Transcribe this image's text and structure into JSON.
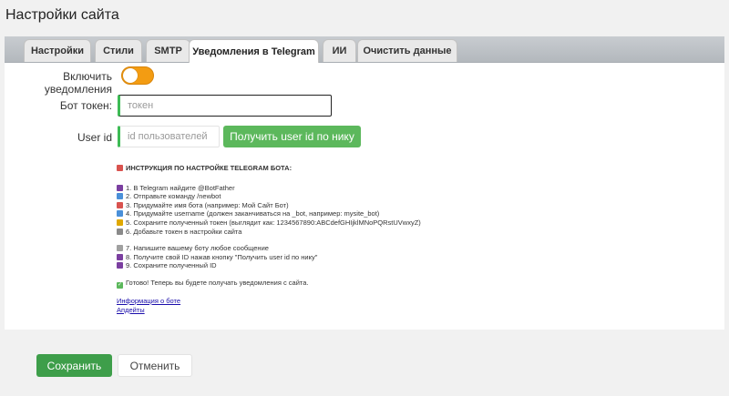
{
  "page": {
    "title": "Настройки сайта"
  },
  "tabs": [
    {
      "label": "Настройки"
    },
    {
      "label": "Стили"
    },
    {
      "label": "SMTP"
    },
    {
      "label": "Уведомления в Telegram",
      "active": true
    },
    {
      "label": "ИИ"
    },
    {
      "label": "Очистить данные"
    }
  ],
  "form": {
    "enable_label": "Включить уведомления",
    "enable_value": true,
    "token_label": "Бот токен:",
    "token_placeholder": "токен",
    "token_value": "",
    "userid_label": "User id",
    "userid_placeholder": "id пользователей",
    "userid_value": "",
    "get_userid_button": "Получить user id по нику"
  },
  "instructions": {
    "heading": "ИНСТРУКЦИЯ ПО НАСТРОЙКЕ TELEGRAM БОТА:",
    "steps_a": [
      {
        "text": "1. В Telegram найдите @BotFather",
        "icon": "phone-icon",
        "color": "#7b3fa0"
      },
      {
        "text": "2. Отправьте команду /newbot",
        "icon": "new-icon",
        "color": "#4a90d9"
      },
      {
        "text": "3. Придумайте имя бота (например: Мой Сайт Бот)",
        "icon": "name-badge-icon",
        "color": "#d9534f"
      },
      {
        "text": "4. Придумайте username (должен заканчиваться на _bot, например: mysite_bot)",
        "icon": "abc-icon",
        "color": "#4a90d9"
      },
      {
        "text": "5. Сохраните полученный токен (выглядит как: 1234567890:ABCdefGHIjklMNoPQRstUVwxyZ)",
        "icon": "key-icon",
        "color": "#e0a800"
      },
      {
        "text": "6. Добавьте токен в настройки сайта",
        "icon": "gear-icon",
        "color": "#8a8a8a"
      }
    ],
    "steps_b": [
      {
        "text": "7. Напишите вашему боту любое сообщение",
        "icon": "chat-icon",
        "color": "#a0a0a0"
      },
      {
        "text": "8. Получите свой ID нажав кнопку \"Получить user id по нику\"",
        "icon": "id-icon",
        "color": "#7b3fa0"
      },
      {
        "text": "9. Сохраните полученный ID",
        "icon": "plus-icon",
        "color": "#7b3fa0"
      }
    ],
    "done_text": "Готово! Теперь вы будете получать уведомления с сайта.",
    "done_icon": "check-icon",
    "links": [
      {
        "label": "Информация о боте"
      },
      {
        "label": "Апдейты"
      }
    ]
  },
  "footer": {
    "save_label": "Сохранить",
    "cancel_label": "Отменить"
  }
}
